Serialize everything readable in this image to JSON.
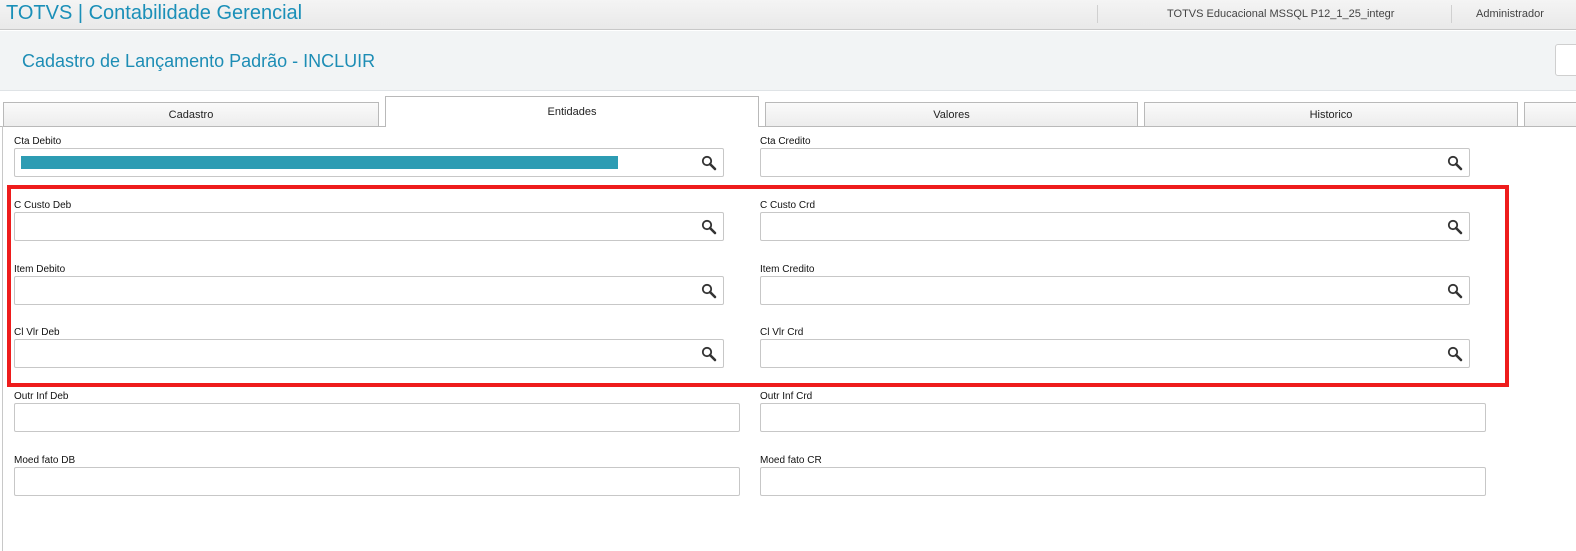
{
  "app": {
    "title": "TOTVS | Contabilidade Gerencial",
    "environment": "TOTVS Educacional MSSQL P12_1_25_integr",
    "user": "Administrador"
  },
  "page": {
    "title": "Cadastro de Lançamento Padrão - INCLUIR"
  },
  "tabs": [
    {
      "label": "Cadastro",
      "active": false
    },
    {
      "label": "Entidades",
      "active": true
    },
    {
      "label": "Valores",
      "active": false
    },
    {
      "label": "Historico",
      "active": false
    }
  ],
  "fields": {
    "cta_debito": {
      "label": "Cta Debito",
      "value": "",
      "has_lookup": true,
      "selected_fill_color": "#2d9cb3"
    },
    "cta_credito": {
      "label": "Cta Credito",
      "value": "",
      "has_lookup": true
    },
    "c_custo_deb": {
      "label": "C Custo Deb",
      "value": "",
      "has_lookup": true
    },
    "c_custo_crd": {
      "label": "C Custo Crd",
      "value": "",
      "has_lookup": true
    },
    "item_debito": {
      "label": "Item Debito",
      "value": "",
      "has_lookup": true
    },
    "item_credito": {
      "label": "Item Credito",
      "value": "",
      "has_lookup": true
    },
    "cl_vlr_deb": {
      "label": "Cl Vlr Deb",
      "value": "",
      "has_lookup": true
    },
    "cl_vlr_crd": {
      "label": "Cl Vlr Crd",
      "value": "",
      "has_lookup": true
    },
    "outr_inf_deb": {
      "label": "Outr Inf Deb",
      "value": "",
      "has_lookup": false
    },
    "outr_inf_crd": {
      "label": "Outr Inf Crd",
      "value": "",
      "has_lookup": false
    },
    "moed_fato_db": {
      "label": "Moed fato DB",
      "value": "",
      "has_lookup": false
    },
    "moed_fato_cr": {
      "label": "Moed fato CR",
      "value": "",
      "has_lookup": false
    }
  },
  "highlight": {
    "color": "#ee1c1c"
  },
  "colors": {
    "accent": "#1d8db5"
  }
}
